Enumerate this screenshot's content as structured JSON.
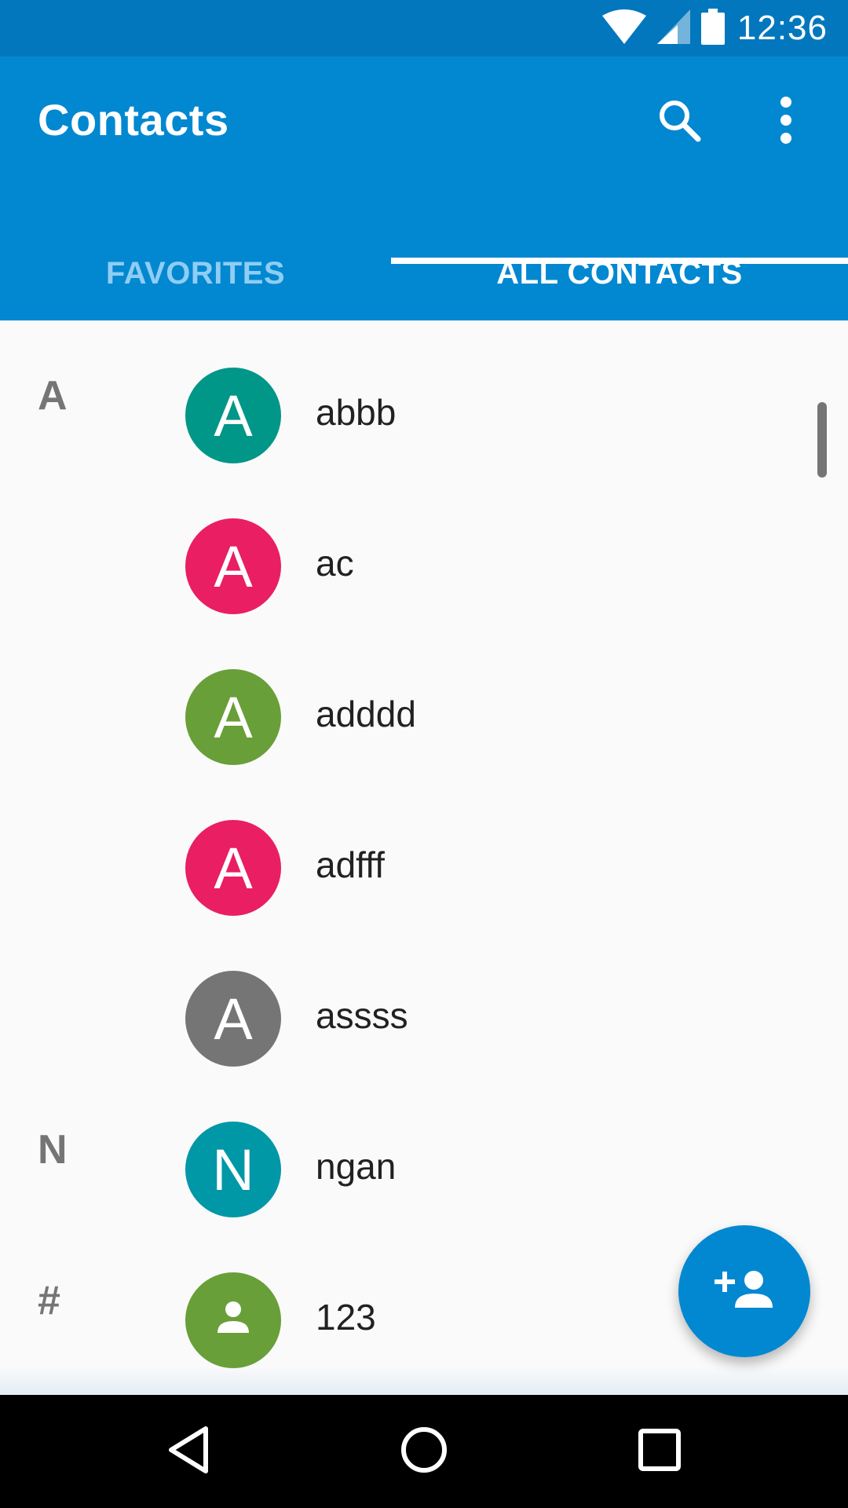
{
  "status_bar": {
    "time": "12:36",
    "icons": [
      "wifi-icon",
      "signal-icon",
      "battery-icon"
    ]
  },
  "app_bar": {
    "title": "Contacts",
    "actions": [
      "search-icon",
      "more-vert-icon"
    ]
  },
  "tabs": [
    {
      "label": "FAVORITES",
      "selected": false
    },
    {
      "label": "ALL CONTACTS",
      "selected": true
    }
  ],
  "contacts": [
    {
      "section": "A",
      "initial": "A",
      "name": "abbb",
      "color": "#009688"
    },
    {
      "section": "",
      "initial": "A",
      "name": "ac",
      "color": "#e91e63"
    },
    {
      "section": "",
      "initial": "A",
      "name": "adddd",
      "color": "#689f38"
    },
    {
      "section": "",
      "initial": "A",
      "name": "adfff",
      "color": "#e91e63"
    },
    {
      "section": "",
      "initial": "A",
      "name": "assss",
      "color": "#757575"
    },
    {
      "section": "N",
      "initial": "N",
      "name": "ngan",
      "color": "#0097a7"
    },
    {
      "section": "#",
      "initial": "",
      "name": "123",
      "color": "#689f38",
      "icon": "person-icon"
    }
  ],
  "fab": {
    "icon": "add-person-icon"
  },
  "nav_bar": {
    "buttons": [
      "back-icon",
      "home-icon",
      "recents-icon"
    ]
  },
  "colors": {
    "status_bar": "#0277bd",
    "app_bar": "#0288d1",
    "accent": "#0288d1"
  }
}
